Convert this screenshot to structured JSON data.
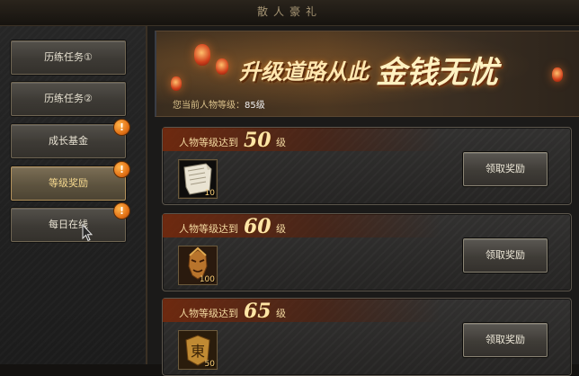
{
  "header": {
    "title": "散人豪礼"
  },
  "sidebar": {
    "items": [
      {
        "label": "历练任务①",
        "badge": ""
      },
      {
        "label": "历练任务②",
        "badge": ""
      },
      {
        "label": "成长基金",
        "badge": "!"
      },
      {
        "label": "等级奖励",
        "badge": "!"
      },
      {
        "label": "每日在线",
        "badge": "!"
      }
    ],
    "active_index": 3
  },
  "banner": {
    "title_part1": "升级道路从此",
    "title_part2": "金钱无忧",
    "level_label": "您当前人物等级：",
    "level_value": "85级"
  },
  "rewards": [
    {
      "prefix": "人物等级达到",
      "level": "50",
      "suffix": "级",
      "item_icon": "scroll-icon",
      "item_qty": "10",
      "button_label": "领取奖励"
    },
    {
      "prefix": "人物等级达到",
      "level": "60",
      "suffix": "级",
      "item_icon": "warrior-head-icon",
      "item_qty": "100",
      "button_label": "领取奖励"
    },
    {
      "prefix": "人物等级达到",
      "level": "65",
      "suffix": "级",
      "item_icon": "east-badge-icon",
      "item_qty": "50",
      "button_label": "领取奖励"
    }
  ],
  "colors": {
    "accent_gold": "#f3d9a0",
    "badge_orange": "#e37216",
    "active_tab_text": "#f5d88e"
  }
}
